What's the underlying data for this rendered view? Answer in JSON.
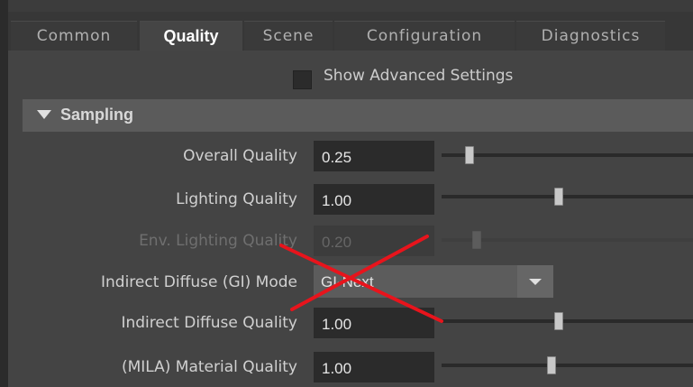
{
  "tabs": [
    {
      "label": "Common",
      "active": false
    },
    {
      "label": "Quality",
      "active": true
    },
    {
      "label": "Scene",
      "active": false
    },
    {
      "label": "Configuration",
      "active": false
    },
    {
      "label": "Diagnostics",
      "active": false
    }
  ],
  "advanced": {
    "label": "Show Advanced Settings",
    "checked": false
  },
  "section": {
    "label": "Sampling",
    "expanded": true
  },
  "rows": [
    {
      "label": "Overall Quality",
      "value": "0.25",
      "slider_fraction": 0.25,
      "enabled": true
    },
    {
      "label": "Lighting Quality",
      "value": "1.00",
      "slider_fraction": 1.0,
      "enabled": true
    },
    {
      "label": "Env. Lighting Quality",
      "value": "0.20",
      "slider_fraction": 0.2,
      "enabled": false
    },
    {
      "label": "Indirect Diffuse (GI) Mode",
      "dropdown_value": "GI-Next",
      "enabled": true
    },
    {
      "label": "Indirect Diffuse Quality",
      "value": "1.00",
      "slider_fraction": 1.0,
      "enabled": true
    },
    {
      "label": "(MILA) Material Quality",
      "value": "1.00",
      "slider_fraction": 1.0,
      "enabled": true
    }
  ],
  "annotation": {
    "type": "red-cross",
    "color": "#e8141c"
  },
  "icons": {
    "section_toggle": "triangle-down-icon",
    "dropdown": "chevron-down-icon"
  }
}
